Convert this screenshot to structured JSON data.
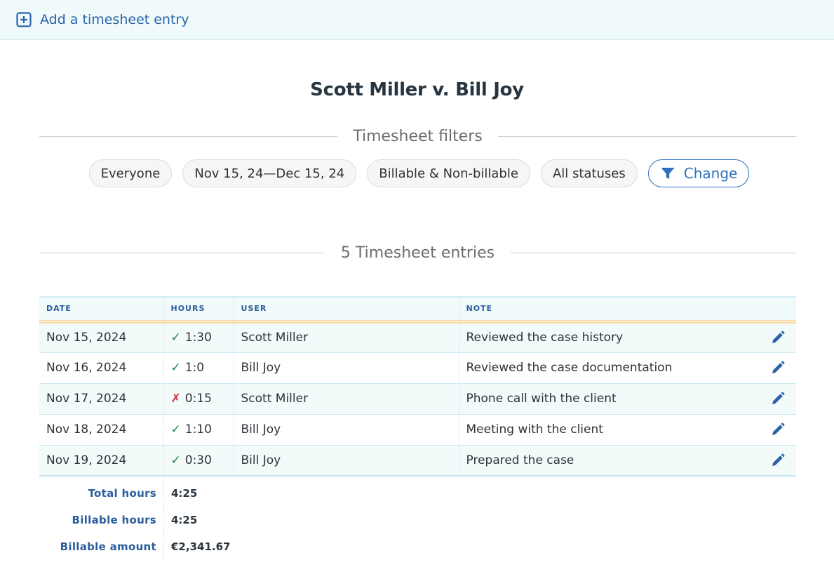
{
  "topbar": {
    "add_entry_label": "Add a timesheet entry"
  },
  "case": {
    "title": "Scott Miller v. Bill Joy"
  },
  "filters": {
    "heading": "Timesheet filters",
    "chips": [
      "Everyone",
      "Nov 15, 24—Dec 15, 24",
      "Billable & Non-billable",
      "All statuses"
    ],
    "change_label": "Change"
  },
  "entries": {
    "heading": "5 Timesheet entries",
    "columns": {
      "date": "DATE",
      "hours": "HOURS",
      "user": "USER",
      "note": "NOTE"
    },
    "rows": [
      {
        "date": "Nov 15, 2024",
        "status": "approved",
        "status_glyph": "✓",
        "hours": "1:30",
        "user": "Scott Miller",
        "note": "Reviewed the case history"
      },
      {
        "date": "Nov 16, 2024",
        "status": "approved",
        "status_glyph": "✓",
        "hours": "1:0",
        "user": "Bill Joy",
        "note": "Reviewed the case documentation"
      },
      {
        "date": "Nov 17, 2024",
        "status": "rejected",
        "status_glyph": "✗",
        "hours": "0:15",
        "user": "Scott Miller",
        "note": "Phone call with the client"
      },
      {
        "date": "Nov 18, 2024",
        "status": "approved",
        "status_glyph": "✓",
        "hours": "1:10",
        "user": "Bill Joy",
        "note": "Meeting with the client"
      },
      {
        "date": "Nov 19, 2024",
        "status": "approved",
        "status_glyph": "✓",
        "hours": "0:30",
        "user": "Bill Joy",
        "note": "Prepared the case"
      }
    ]
  },
  "totals": {
    "total_hours_label": "Total hours",
    "total_hours": "4:25",
    "billable_hours_label": "Billable hours",
    "billable_hours": "4:25",
    "billable_amount_label": "Billable amount",
    "billable_amount": "€2,341.67"
  },
  "colors": {
    "accent": "#2f6fbd",
    "approved": "#1e8a3a",
    "rejected": "#d12f2f"
  }
}
